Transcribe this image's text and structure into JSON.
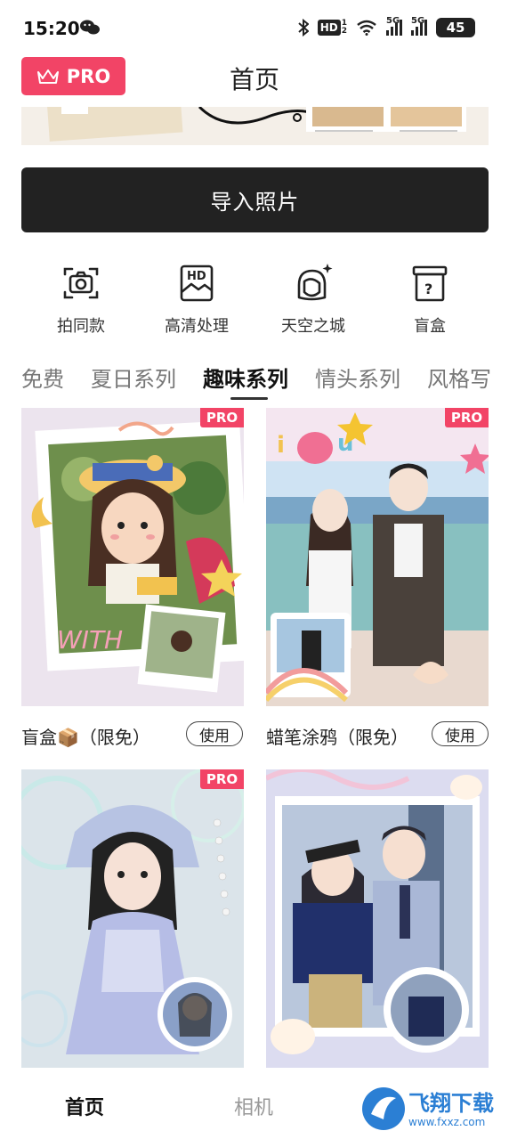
{
  "status_bar": {
    "time": "15:20",
    "hd_label": "HD",
    "signal1": "5G",
    "signal2": "5G",
    "battery": "45",
    "icons": [
      "wechat-icon",
      "bluetooth-icon",
      "wifi-icon",
      "signal-icon",
      "battery-icon"
    ]
  },
  "header": {
    "pro_label": "PRO",
    "title": "首页"
  },
  "import_button": {
    "label": "导入照片"
  },
  "features": [
    {
      "label": "拍同款",
      "icon": "camera-frame-icon"
    },
    {
      "label": "高清处理",
      "icon": "hd-image-icon"
    },
    {
      "label": "天空之城",
      "icon": "avatar-sparkle-icon"
    },
    {
      "label": "盲盒",
      "icon": "mystery-box-icon"
    }
  ],
  "tabs": [
    {
      "label": "免费",
      "active": false
    },
    {
      "label": "夏日系列",
      "active": false
    },
    {
      "label": "趣味系列",
      "active": true
    },
    {
      "label": "情头系列",
      "active": false
    },
    {
      "label": "风格写",
      "active": false
    }
  ],
  "cards": [
    {
      "title": "盲盒📦（限免）",
      "pro": "PRO",
      "button": "使用"
    },
    {
      "title": "蜡笔涂鸦（限免）",
      "pro": "PRO",
      "button": "使用"
    },
    {
      "title": "",
      "pro": "PRO",
      "button": ""
    },
    {
      "title": "",
      "pro": "",
      "button": ""
    }
  ],
  "bottom_nav": {
    "home": "首页",
    "camera": "相机"
  },
  "watermark": {
    "text": "飞翔下载",
    "url": "www.fxxz.com"
  },
  "colors": {
    "accent": "#f24466",
    "dark": "#222222"
  }
}
